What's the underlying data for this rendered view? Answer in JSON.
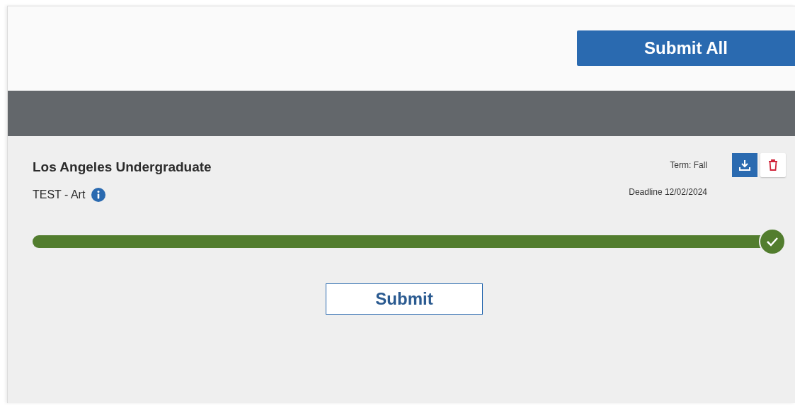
{
  "header": {
    "submit_all_button": "Submit All"
  },
  "application": {
    "title": "Los Angeles Undergraduate",
    "program": "TEST - Art",
    "term": "Term: Fall",
    "deadline": "Deadline 12/02/2024",
    "progress": {
      "level": 1,
      "complete": true
    },
    "submit_button": "Submit"
  }
}
